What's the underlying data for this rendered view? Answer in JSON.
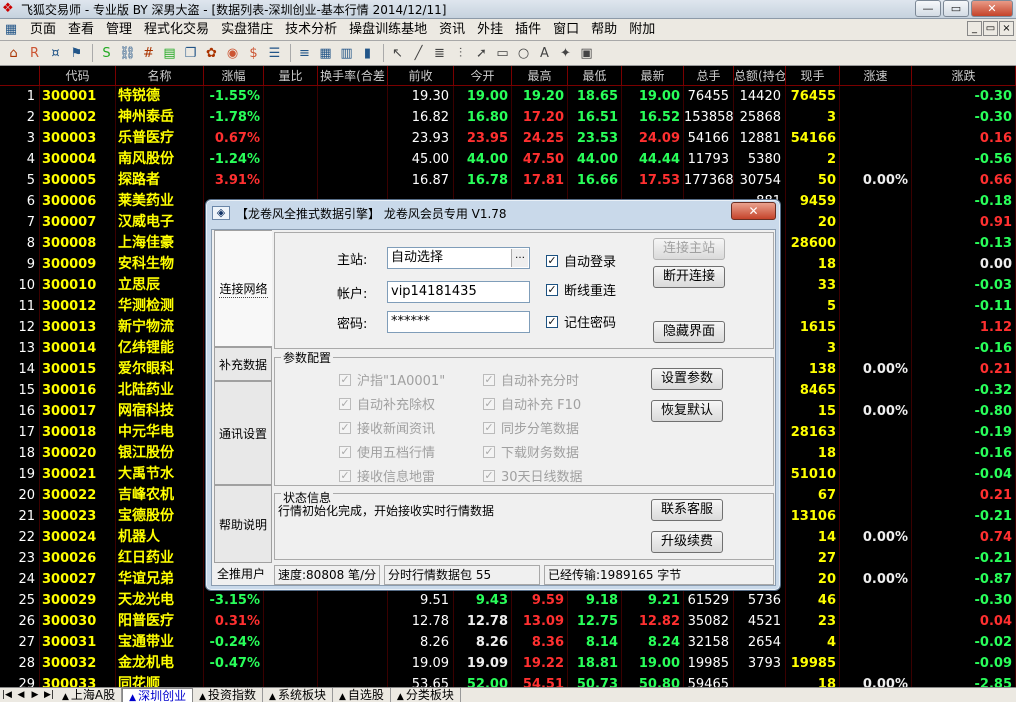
{
  "window": {
    "title": "飞狐交易师 - 专业版 BY 深男大盗 - [数据列表-深圳创业-基本行情 2014/12/11]",
    "min": "—",
    "restore": "▭",
    "close": "✕"
  },
  "menu": [
    "页面",
    "查看",
    "管理",
    "程式化交易",
    "实盘猎庄",
    "技术分析",
    "操盘训练基地",
    "资讯",
    "外挂",
    "插件",
    "窗口",
    "帮助",
    "附加"
  ],
  "mdi": [
    "_",
    "▭",
    "×"
  ],
  "toolbar_icons": [
    "home-icon",
    "rsi-icon",
    "coin-icon",
    "flag-icon",
    "stock-icon",
    "link-icon",
    "calc-icon",
    "chart-icon",
    "book-icon",
    "gear-icon",
    "alarm-icon",
    "money-icon",
    "report-icon",
    "list-icon",
    "grid-icon",
    "table-icon",
    "bar-chart-icon",
    "cursor-icon",
    "line-draw-icon",
    "channel-icon",
    "fibonacci-icon",
    "arrow-icon",
    "rect-icon",
    "circle-icon",
    "text-icon",
    "mark-icon",
    "save-icon"
  ],
  "columns": [
    {
      "key": "idx",
      "label": ""
    },
    {
      "key": "code",
      "label": "代码"
    },
    {
      "key": "name",
      "label": "名称"
    },
    {
      "key": "chg",
      "label": "涨幅"
    },
    {
      "key": "vr",
      "label": "量比"
    },
    {
      "key": "turn",
      "label": "换手率(合差"
    },
    {
      "key": "prev",
      "label": "前收"
    },
    {
      "key": "open",
      "label": "今开"
    },
    {
      "key": "high",
      "label": "最高"
    },
    {
      "key": "low",
      "label": "最低"
    },
    {
      "key": "last",
      "label": "最新"
    },
    {
      "key": "vol",
      "label": "总手"
    },
    {
      "key": "amt",
      "label": "总额(持仓)"
    },
    {
      "key": "cur",
      "label": "现手"
    },
    {
      "key": "speed",
      "label": "涨速"
    },
    {
      "key": "diff",
      "label": "涨跌"
    }
  ],
  "rows": [
    {
      "idx": "1",
      "code": "300001",
      "name": "特锐德",
      "chg": "-1.55%",
      "prev": "19.30",
      "open": "19.00",
      "high": "19.20",
      "low": "18.65",
      "last": "19.00",
      "vol": "76455",
      "amt": "14420",
      "cur": "76455",
      "speed": "",
      "diff": "-0.30"
    },
    {
      "idx": "2",
      "code": "300002",
      "name": "神州泰岳",
      "chg": "-1.78%",
      "prev": "16.82",
      "open": "16.80",
      "high": "17.20",
      "low": "16.51",
      "last": "16.52",
      "vol": "153858",
      "amt": "25868",
      "cur": "3",
      "speed": "",
      "diff": "-0.30"
    },
    {
      "idx": "3",
      "code": "300003",
      "name": "乐普医疗",
      "chg": "0.67%",
      "prev": "23.93",
      "open": "23.95",
      "high": "24.25",
      "low": "23.53",
      "last": "24.09",
      "vol": "54166",
      "amt": "12881",
      "cur": "54166",
      "speed": "",
      "diff": "0.16"
    },
    {
      "idx": "4",
      "code": "300004",
      "name": "南风股份",
      "chg": "-1.24%",
      "prev": "45.00",
      "open": "44.00",
      "high": "47.50",
      "low": "44.00",
      "last": "44.44",
      "vol": "11793",
      "amt": "5380",
      "cur": "2",
      "speed": "",
      "diff": "-0.56"
    },
    {
      "idx": "5",
      "code": "300005",
      "name": "探路者",
      "chg": "3.91%",
      "prev": "16.87",
      "open": "16.78",
      "high": "17.81",
      "low": "16.66",
      "last": "17.53",
      "vol": "177368",
      "amt": "30754",
      "cur": "50",
      "speed": "0.00%",
      "diff": "0.66"
    },
    {
      "idx": "6",
      "code": "300006",
      "name": "莱美药业",
      "chg": "-",
      "prev": "",
      "open": "",
      "high": "",
      "low": "",
      "last": "",
      "vol": "",
      "amt": "881",
      "cur": "9459",
      "speed": "",
      "diff": "-0.18"
    },
    {
      "idx": "7",
      "code": "300007",
      "name": "汉威电子",
      "chg": "3",
      "prev": "",
      "open": "",
      "high": "",
      "low": "",
      "last": "",
      "vol": "",
      "amt": "012",
      "cur": "20",
      "speed": "",
      "diff": "0.91"
    },
    {
      "idx": "8",
      "code": "300008",
      "name": "上海佳豪",
      "chg": "-0",
      "prev": "",
      "open": "",
      "high": "",
      "low": "",
      "last": "",
      "vol": "",
      "amt": "117",
      "cur": "28600",
      "speed": "",
      "diff": "-0.13"
    },
    {
      "idx": "9",
      "code": "300009",
      "name": "安科生物",
      "chg": "0",
      "prev": "",
      "open": "",
      "high": "",
      "low": "",
      "last": "",
      "vol": "",
      "amt": "542",
      "cur": "18",
      "speed": "",
      "diff": "0.00"
    },
    {
      "idx": "10",
      "code": "300010",
      "name": "立思辰",
      "chg": "-0",
      "prev": "",
      "open": "",
      "high": "",
      "low": "",
      "last": "",
      "vol": "",
      "amt": "632",
      "cur": "33",
      "speed": "",
      "diff": "-0.03"
    },
    {
      "idx": "11",
      "code": "300012",
      "name": "华测检测",
      "chg": "-0",
      "prev": "",
      "open": "",
      "high": "",
      "low": "",
      "last": "",
      "vol": "",
      "amt": "487",
      "cur": "5",
      "speed": "",
      "diff": "-0.11"
    },
    {
      "idx": "12",
      "code": "300013",
      "name": "新宁物流",
      "chg": "9",
      "prev": "",
      "open": "",
      "high": "",
      "low": "",
      "last": "",
      "vol": "",
      "amt": "199",
      "cur": "1615",
      "speed": "",
      "diff": "1.12"
    },
    {
      "idx": "13",
      "code": "300014",
      "name": "亿纬锂能",
      "chg": "-0",
      "prev": "",
      "open": "",
      "high": "",
      "low": "",
      "last": "",
      "vol": "",
      "amt": "116",
      "cur": "3",
      "speed": "",
      "diff": "-0.16"
    },
    {
      "idx": "14",
      "code": "300015",
      "name": "爱尔眼科",
      "chg": "0",
      "prev": "",
      "open": "",
      "high": "",
      "low": "",
      "last": "",
      "vol": "",
      "amt": "046",
      "cur": "138",
      "speed": "0.00%",
      "diff": "0.21"
    },
    {
      "idx": "15",
      "code": "300016",
      "name": "北陆药业",
      "chg": "-1",
      "prev": "",
      "open": "",
      "high": "",
      "low": "",
      "last": "",
      "vol": "",
      "amt": "362",
      "cur": "8465",
      "speed": "",
      "diff": "-0.32"
    },
    {
      "idx": "16",
      "code": "300017",
      "name": "网宿科技",
      "chg": "-1",
      "prev": "",
      "open": "",
      "high": "",
      "low": "",
      "last": "",
      "vol": "",
      "amt": "387",
      "cur": "15",
      "speed": "0.00%",
      "diff": "-0.80"
    },
    {
      "idx": "17",
      "code": "300018",
      "name": "中元华电",
      "chg": "-1",
      "prev": "",
      "open": "",
      "high": "",
      "low": "",
      "last": "",
      "vol": "",
      "amt": "858",
      "cur": "28163",
      "speed": "",
      "diff": "-0.19"
    },
    {
      "idx": "18",
      "code": "300020",
      "name": "银江股份",
      "chg": "-0",
      "prev": "",
      "open": "",
      "high": "",
      "low": "",
      "last": "",
      "vol": "",
      "amt": "588",
      "cur": "18",
      "speed": "",
      "diff": "-0.16"
    },
    {
      "idx": "19",
      "code": "300021",
      "name": "大禹节水",
      "chg": "-0",
      "prev": "",
      "open": "",
      "high": "",
      "low": "",
      "last": "",
      "vol": "",
      "amt": "906",
      "cur": "51010",
      "speed": "",
      "diff": "-0.04"
    },
    {
      "idx": "20",
      "code": "300022",
      "name": "吉峰农机",
      "chg": "2",
      "prev": "",
      "open": "",
      "high": "",
      "low": "",
      "last": "",
      "vol": "",
      "amt": "699",
      "cur": "67",
      "speed": "",
      "diff": "0.21"
    },
    {
      "idx": "21",
      "code": "300023",
      "name": "宝德股份",
      "chg": "-1",
      "prev": "",
      "open": "",
      "high": "",
      "low": "",
      "last": "",
      "vol": "",
      "amt": "193",
      "cur": "13106",
      "speed": "",
      "diff": "-0.21"
    },
    {
      "idx": "22",
      "code": "300024",
      "name": "机器人",
      "chg": "1",
      "prev": "",
      "open": "",
      "high": "",
      "low": "",
      "last": "",
      "vol": "",
      "amt": "824",
      "cur": "14",
      "speed": "0.00%",
      "diff": "0.74"
    },
    {
      "idx": "23",
      "code": "300026",
      "name": "红日药业",
      "chg": "-0",
      "prev": "",
      "open": "",
      "high": "",
      "low": "",
      "last": "",
      "vol": "",
      "amt": "853",
      "cur": "27",
      "speed": "",
      "diff": "-0.21"
    },
    {
      "idx": "24",
      "code": "300027",
      "name": "华谊兄弟",
      "chg": "-3",
      "prev": "",
      "open": "",
      "high": "",
      "low": "",
      "last": "",
      "vol": "",
      "amt": "993",
      "cur": "20",
      "speed": "0.00%",
      "diff": "-0.87"
    },
    {
      "idx": "25",
      "code": "300029",
      "name": "天龙光电",
      "chg": "-3.15%",
      "prev": "9.51",
      "open": "9.43",
      "high": "9.59",
      "low": "9.18",
      "last": "9.21",
      "vol": "61529",
      "amt": "5736",
      "cur": "46",
      "speed": "",
      "diff": "-0.30"
    },
    {
      "idx": "26",
      "code": "300030",
      "name": "阳普医疗",
      "chg": "0.31%",
      "prev": "12.78",
      "open": "12.78",
      "high": "13.09",
      "low": "12.75",
      "last": "12.82",
      "vol": "35082",
      "amt": "4521",
      "cur": "23",
      "speed": "",
      "diff": "0.04"
    },
    {
      "idx": "27",
      "code": "300031",
      "name": "宝通带业",
      "chg": "-0.24%",
      "prev": "8.26",
      "open": "8.26",
      "high": "8.36",
      "low": "8.14",
      "last": "8.24",
      "vol": "32158",
      "amt": "2654",
      "cur": "4",
      "speed": "",
      "diff": "-0.02"
    },
    {
      "idx": "28",
      "code": "300032",
      "name": "金龙机电",
      "chg": "-0.47%",
      "prev": "19.09",
      "open": "19.09",
      "high": "19.22",
      "low": "18.81",
      "last": "19.00",
      "vol": "19985",
      "amt": "3793",
      "cur": "19985",
      "speed": "",
      "diff": "-0.09"
    },
    {
      "idx": "29",
      "code": "300033",
      "name": "同花顺",
      "chg": "",
      "prev": "53.65",
      "open": "52.00",
      "high": "54.51",
      "low": "50.73",
      "last": "50.80",
      "vol": "59465",
      "amt": "",
      "cur": "18",
      "speed": "0.00%",
      "diff": "-2.85"
    }
  ],
  "sheet_tabs": [
    "上海A股",
    "深圳创业",
    "投资指数",
    "系统板块",
    "自选股",
    "分类板块"
  ],
  "sheet_active": "深圳创业",
  "dialog": {
    "title": "【龙卷风全推式数据引擎】 龙卷风会员专用 V1.78",
    "close": "✕",
    "tabs": [
      "连接网络",
      "补充数据",
      "通讯设置",
      "帮助说明"
    ],
    "station_label": "主站:",
    "station_value": "自动选择",
    "account_label": "帐户:",
    "account_value": "vip14181435",
    "password_label": "密码:",
    "password_value": "******",
    "auto_login": "自动登录",
    "reconnect": "断线重连",
    "remember": "记住密码",
    "btn_connect": "连接主站",
    "btn_disconnect": "断开连接",
    "btn_hide": "隐藏界面",
    "config_title": "参数配置",
    "opts_left": [
      "沪指\"1A0001\"",
      "自动补充除权",
      "接收新闻资讯",
      "使用五档行情",
      "接收信息地雷"
    ],
    "opts_right": [
      "自动补充分时",
      "自动补充 F10",
      "同步分笔数据",
      "下载财务数据",
      "30天日线数据"
    ],
    "btn_set": "设置参数",
    "btn_default": "恢复默认",
    "status_title": "状态信息",
    "status_text": "行情初始化完成，开始接收实时行情数据",
    "btn_service": "联系客服",
    "btn_upgrade": "升级续费",
    "foot_user": "全推用户",
    "foot_speed": "速度:80808 笔/分",
    "foot_packets": "分时行情数据包  55",
    "foot_bytes": "已经传输:1989165 字节"
  }
}
